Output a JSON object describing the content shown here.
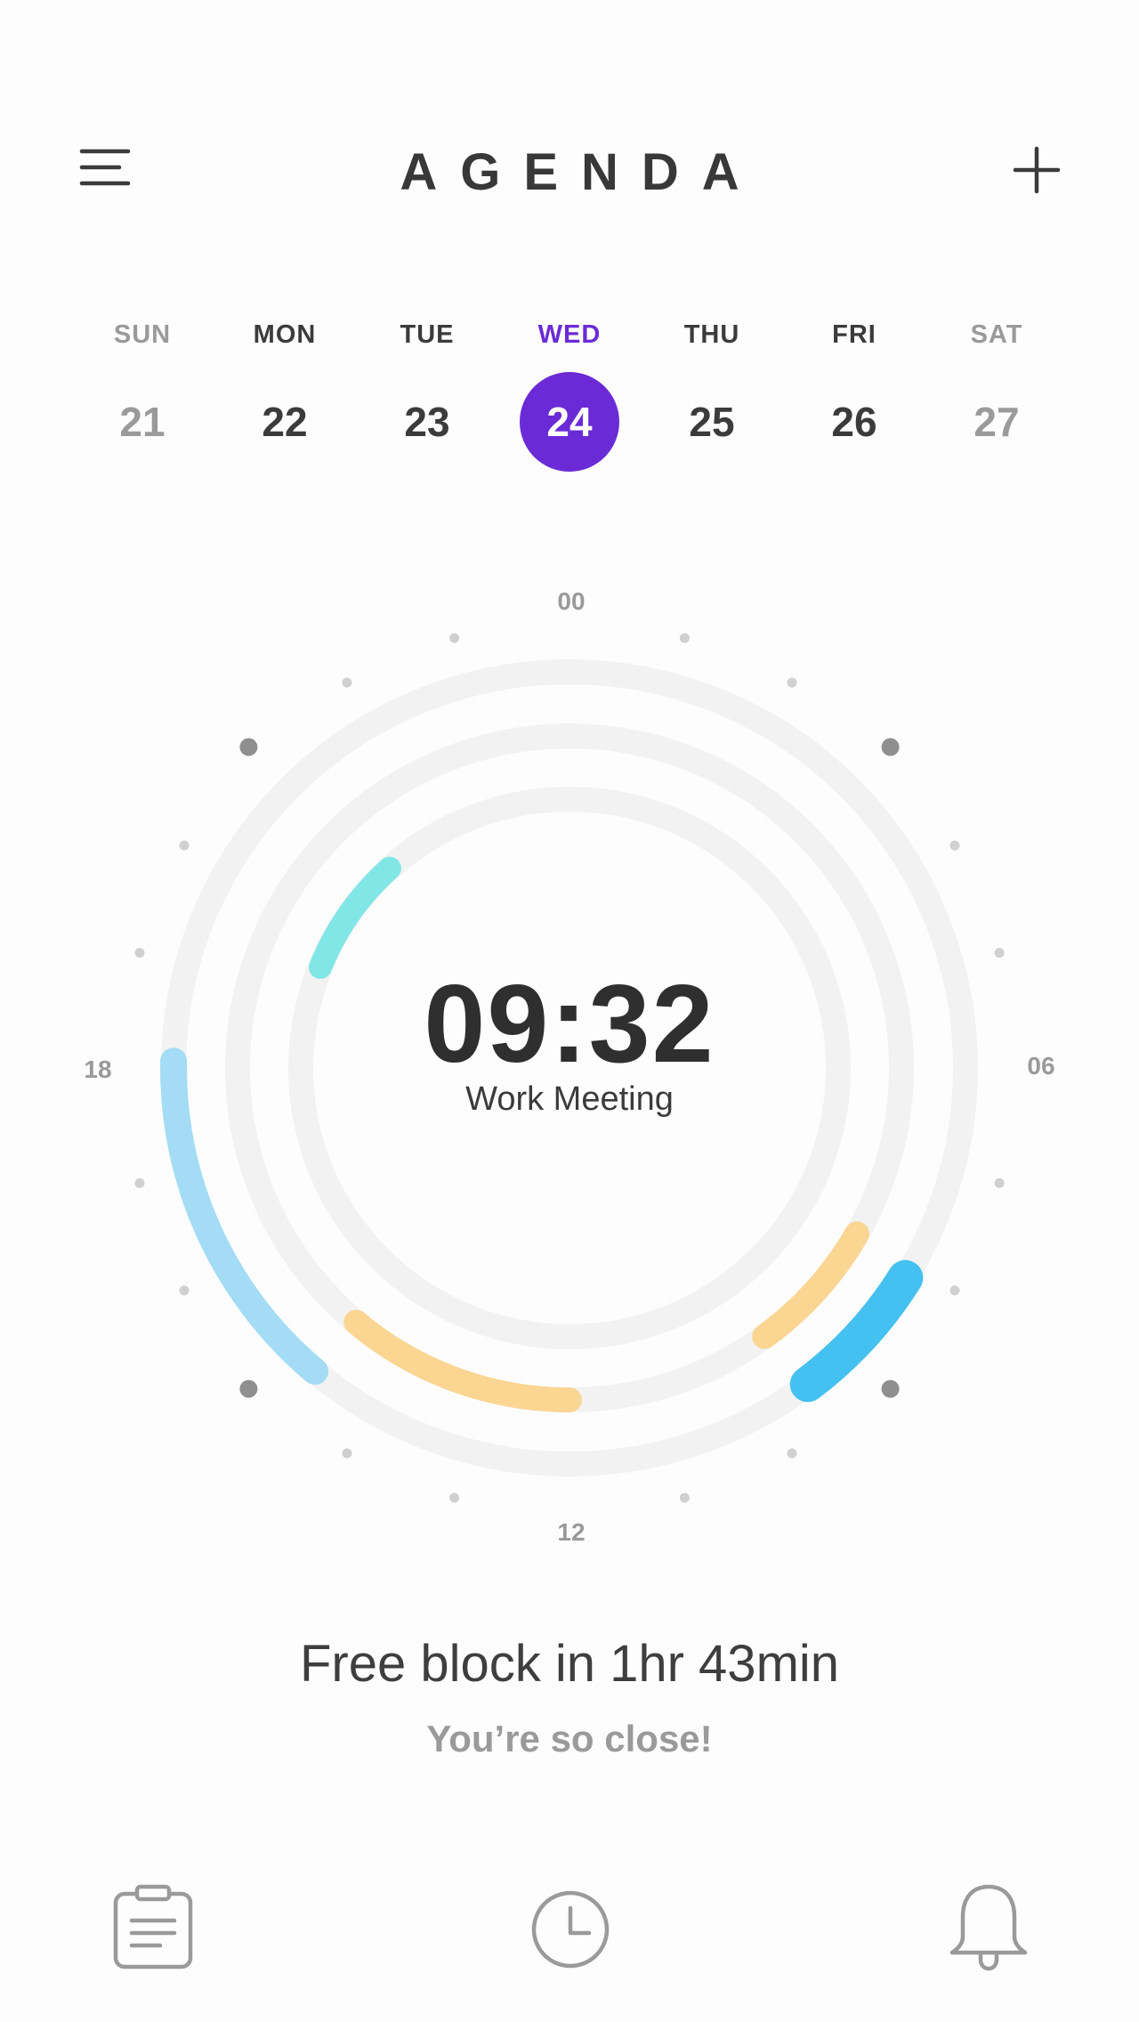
{
  "header": {
    "title": "AGENDA",
    "menu_icon": "hamburger-menu-icon",
    "add_icon": "plus-icon"
  },
  "week": {
    "days": [
      {
        "name": "SUN",
        "number": "21",
        "state": "weekend"
      },
      {
        "name": "MON",
        "number": "22",
        "state": "normal"
      },
      {
        "name": "TUE",
        "number": "23",
        "state": "normal"
      },
      {
        "name": "WED",
        "number": "24",
        "state": "selected"
      },
      {
        "name": "THU",
        "number": "25",
        "state": "normal"
      },
      {
        "name": "FRI",
        "number": "26",
        "state": "normal"
      },
      {
        "name": "SAT",
        "number": "27",
        "state": "weekend"
      }
    ]
  },
  "clock": {
    "hour_labels": {
      "top": "00",
      "right": "06",
      "bottom": "12",
      "left": "18"
    },
    "current_time": "09:32",
    "current_event": "Work Meeting"
  },
  "status": {
    "message": "Free block in 1hr 43min",
    "encouragement": "You’re so close!"
  },
  "bottom_nav": {
    "items": [
      {
        "icon": "clipboard-icon"
      },
      {
        "icon": "clock-icon"
      },
      {
        "icon": "bell-icon"
      }
    ]
  },
  "colors": {
    "accent": "#6a2bd6",
    "ring_track": "#f2f2f2",
    "event_light_blue": "#a3dcf4",
    "event_blue": "#44c1f0",
    "event_orange": "#fbd592",
    "event_teal": "#80e6e6"
  }
}
